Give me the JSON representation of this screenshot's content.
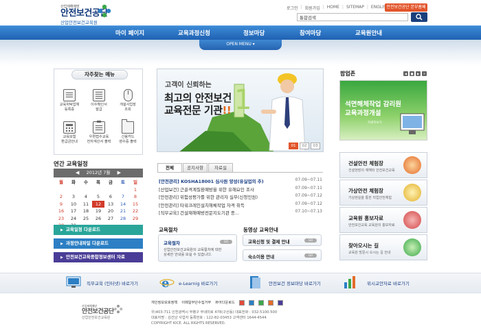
{
  "header": {
    "logo_small": "산업재해예방",
    "logo_main": "안전보건공단",
    "logo_sub": "산업안전보건교육원",
    "top_links": [
      "로그인",
      "회원가입",
      "HOME",
      "SITEMAP",
      "ENGLISH"
    ],
    "kosha_link": "안전보건공단 본부홈페이지",
    "search_value": "통합검색",
    "colors": {
      "nav": "#2a6fc0",
      "accent": "#e2552b",
      "dark": "#1b3f7c"
    }
  },
  "nav": {
    "items": [
      "마이 페이지",
      "교육과정신청",
      "정보마당",
      "참여마당",
      "교육원안내"
    ],
    "open_menu": "OPEN MENU"
  },
  "quick": {
    "title": "자주찾는 메뉴",
    "items": [
      {
        "l1": "교육위탁업체",
        "l2": "등록증",
        "icon": "certificate-icon"
      },
      {
        "l1": "이수확인서",
        "l2": "발급",
        "icon": "document-icon"
      },
      {
        "l1": "개설사업장",
        "l2": "조회",
        "icon": "mouse-icon"
      },
      {
        "l1": "교육보험",
        "l2": "환급금안내",
        "icon": "calculator-icon"
      },
      {
        "l1": "우편접수교육",
        "l2": "전자계산서 출력",
        "icon": "clipboard-icon"
      },
      {
        "l1": "신용카드",
        "l2": "영수증 출력",
        "icon": "folder-icon"
      }
    ]
  },
  "calendar": {
    "title": "연간 교육일정",
    "month_label": "2012년 7월",
    "dow": [
      "월",
      "화",
      "수",
      "목",
      "금",
      "토",
      "일"
    ],
    "weeks": [
      [
        "",
        "",
        "",
        "",
        "",
        "",
        "1"
      ],
      [
        "2",
        "3",
        "4",
        "5",
        "6",
        "7",
        "8"
      ],
      [
        "9",
        "10",
        "11",
        "12",
        "13",
        "14",
        "15"
      ],
      [
        "16",
        "17",
        "18",
        "19",
        "20",
        "21",
        "22"
      ],
      [
        "23",
        "24",
        "25",
        "26",
        "27",
        "28",
        "29"
      ],
      [
        "30",
        "31",
        "",
        "",
        "",
        "",
        ""
      ]
    ]
  },
  "left_buttons": [
    {
      "label": "교육일정 다운로드",
      "color": "#2aa59a"
    },
    {
      "label": "과정안내파일 다운로드",
      "color": "#2c7fc4"
    },
    {
      "label": "안전보건교육종합정보센터 자료",
      "color": "#4a3d97"
    }
  ],
  "banner": {
    "line1": "고객이 신뢰하는",
    "line2": "최고의 안전보건",
    "line3_a": "교육전문 기관",
    "line3_b": "!!",
    "pages": [
      "01",
      "02",
      "03"
    ]
  },
  "news": {
    "tabs": [
      "전체",
      "공지사항",
      "자료실"
    ],
    "items": [
      {
        "title": "[안전관리] KOSHA18001 심사원 양성(유실업의 추)",
        "date": "07.09~07.11"
      },
      {
        "title": "[산업보건] 근골격계질환예방을 위한 유해요인 조사",
        "date": "07.09~07.11"
      },
      {
        "title": "[안전관리] 위험성평가를 위한 관리자 실무(신청인원)",
        "date": "07.09~07.12"
      },
      {
        "title": "[안전관리] 타워크레인설치해체작업 자격 취득",
        "date": "07.09~07.12"
      },
      {
        "title": "[직무교육] 건설재해예방전문지도기관 종...",
        "date": "07.10~07.13"
      }
    ]
  },
  "edu_guide": {
    "title": "교육절차",
    "box_label": "교육절차",
    "desc1": "산업안전보건교육원의 교육절차에 대한",
    "desc2": "상세한 안내를 보실 수 있습니다.",
    "pill": "GO"
  },
  "video_guide": {
    "title": "동영상 교육안내",
    "items": [
      "교육신청 및 결제 안내",
      "숙소이용 안내"
    ],
    "pill": "GO"
  },
  "popup": {
    "title": "팝업존",
    "ctrls": [
      "◀",
      "■",
      "▶",
      "+"
    ],
    "text1": "석면해체작업 감리원",
    "text2": "교육과정개설",
    "caption": "자세히보기"
  },
  "side_boxes": [
    {
      "title": "건설안전 체험장",
      "desc": "건설현장의 재해와 안전보건교육",
      "color": "#e46b2a"
    },
    {
      "title": "가상안전 체험장",
      "desc": "가상현실을 통한 직업안전체험",
      "color": "#e2b12a"
    },
    {
      "title": "교육원 홍보자료",
      "desc": "안전보건교육 교육원의 홍보자료",
      "color": "#d24646"
    },
    {
      "title": "찾아오시는 길",
      "desc": "교육원 방문시 오시는 길 안내",
      "color": "#3aa84a"
    }
  ],
  "bottom_links": [
    {
      "label": "직무교육 (인터넷) 바로가기",
      "icon": "monitor-icon"
    },
    {
      "label": "e-Learnig 바로가기",
      "icon": "ie-icon"
    },
    {
      "label": "안전보건 정보마당 바로가기",
      "icon": "book-icon"
    },
    {
      "label": "위시교안자료 바로가기",
      "icon": "chart-icon"
    }
  ],
  "footer": {
    "logo_small": "산업재해예방",
    "logo_main": "안전보건공단",
    "logo_sub": "산업안전보건교육원",
    "links": [
      "개인정보보호정책",
      "이메일무단수집거부",
      "뷰어다운로드"
    ],
    "info1": "우)403-711 인천광역시 부평구 무네미로 478(구산동) 대표전화 : 032-5100-500",
    "info2": "대표자명 : 김건남 사업자 등록번호 : 122-82-03453 고객센터 1644-4544",
    "copyright": "COPYRIGHT KICE. ALL RIGHTS RESERVED."
  }
}
